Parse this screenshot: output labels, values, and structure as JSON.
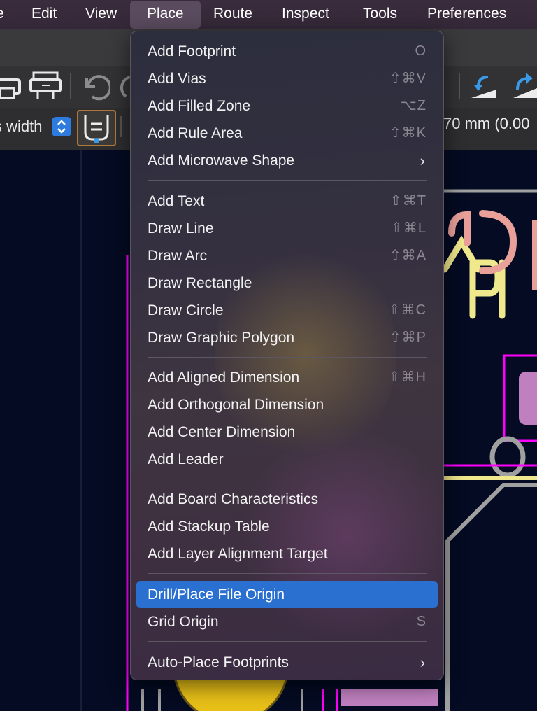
{
  "menubar": {
    "items": [
      "e",
      "Edit",
      "View",
      "Place",
      "Route",
      "Inspect",
      "Tools",
      "Preferences"
    ],
    "active": "Place"
  },
  "toolbar": {
    "track_width_select": "s width",
    "track_width_readout": "70 mm (0.00"
  },
  "place_menu": {
    "items": [
      {
        "label": "Add Footprint",
        "shortcut": "O"
      },
      {
        "label": "Add Vias",
        "shortcut": "⇧⌘V"
      },
      {
        "label": "Add Filled Zone",
        "shortcut": "⌥Z"
      },
      {
        "label": "Add Rule Area",
        "shortcut": "⇧⌘K"
      },
      {
        "label": "Add Microwave Shape",
        "shortcut": "›"
      },
      {
        "label": "Add Text",
        "shortcut": "⇧⌘T"
      },
      {
        "label": "Draw Line",
        "shortcut": "⇧⌘L"
      },
      {
        "label": "Draw Arc",
        "shortcut": "⇧⌘A"
      },
      {
        "label": "Draw Rectangle",
        "shortcut": ""
      },
      {
        "label": "Draw Circle",
        "shortcut": "⇧⌘C"
      },
      {
        "label": "Draw Graphic Polygon",
        "shortcut": "⇧⌘P"
      },
      {
        "label": "Add Aligned Dimension",
        "shortcut": "⇧⌘H"
      },
      {
        "label": "Add Orthogonal Dimension",
        "shortcut": ""
      },
      {
        "label": "Add Center Dimension",
        "shortcut": ""
      },
      {
        "label": "Add Leader",
        "shortcut": ""
      },
      {
        "label": "Add Board Characteristics",
        "shortcut": ""
      },
      {
        "label": "Add Stackup Table",
        "shortcut": ""
      },
      {
        "label": "Add Layer Alignment Target",
        "shortcut": ""
      },
      {
        "label": "Drill/Place File Origin",
        "shortcut": ""
      },
      {
        "label": "Grid Origin",
        "shortcut": "S"
      },
      {
        "label": "Auto-Place Footprints",
        "shortcut": "›"
      }
    ],
    "highlighted": "Drill/Place File Origin"
  },
  "colors": {
    "menu_highlight": "#2a70d0",
    "canvas_bg": "#040b22",
    "board_outline": "#ff00ff",
    "silkscreen": "#f0e88c",
    "copper_pad": "#c080c0",
    "footprint_outline": "#a0a0a0"
  },
  "icons": [
    "print-icon",
    "plot-icon",
    "undo-icon",
    "redo-icon",
    "flip-board-icon",
    "rotate-board-icon",
    "track-width-icon",
    "stepper-icon",
    "chevron-right-icon"
  ]
}
